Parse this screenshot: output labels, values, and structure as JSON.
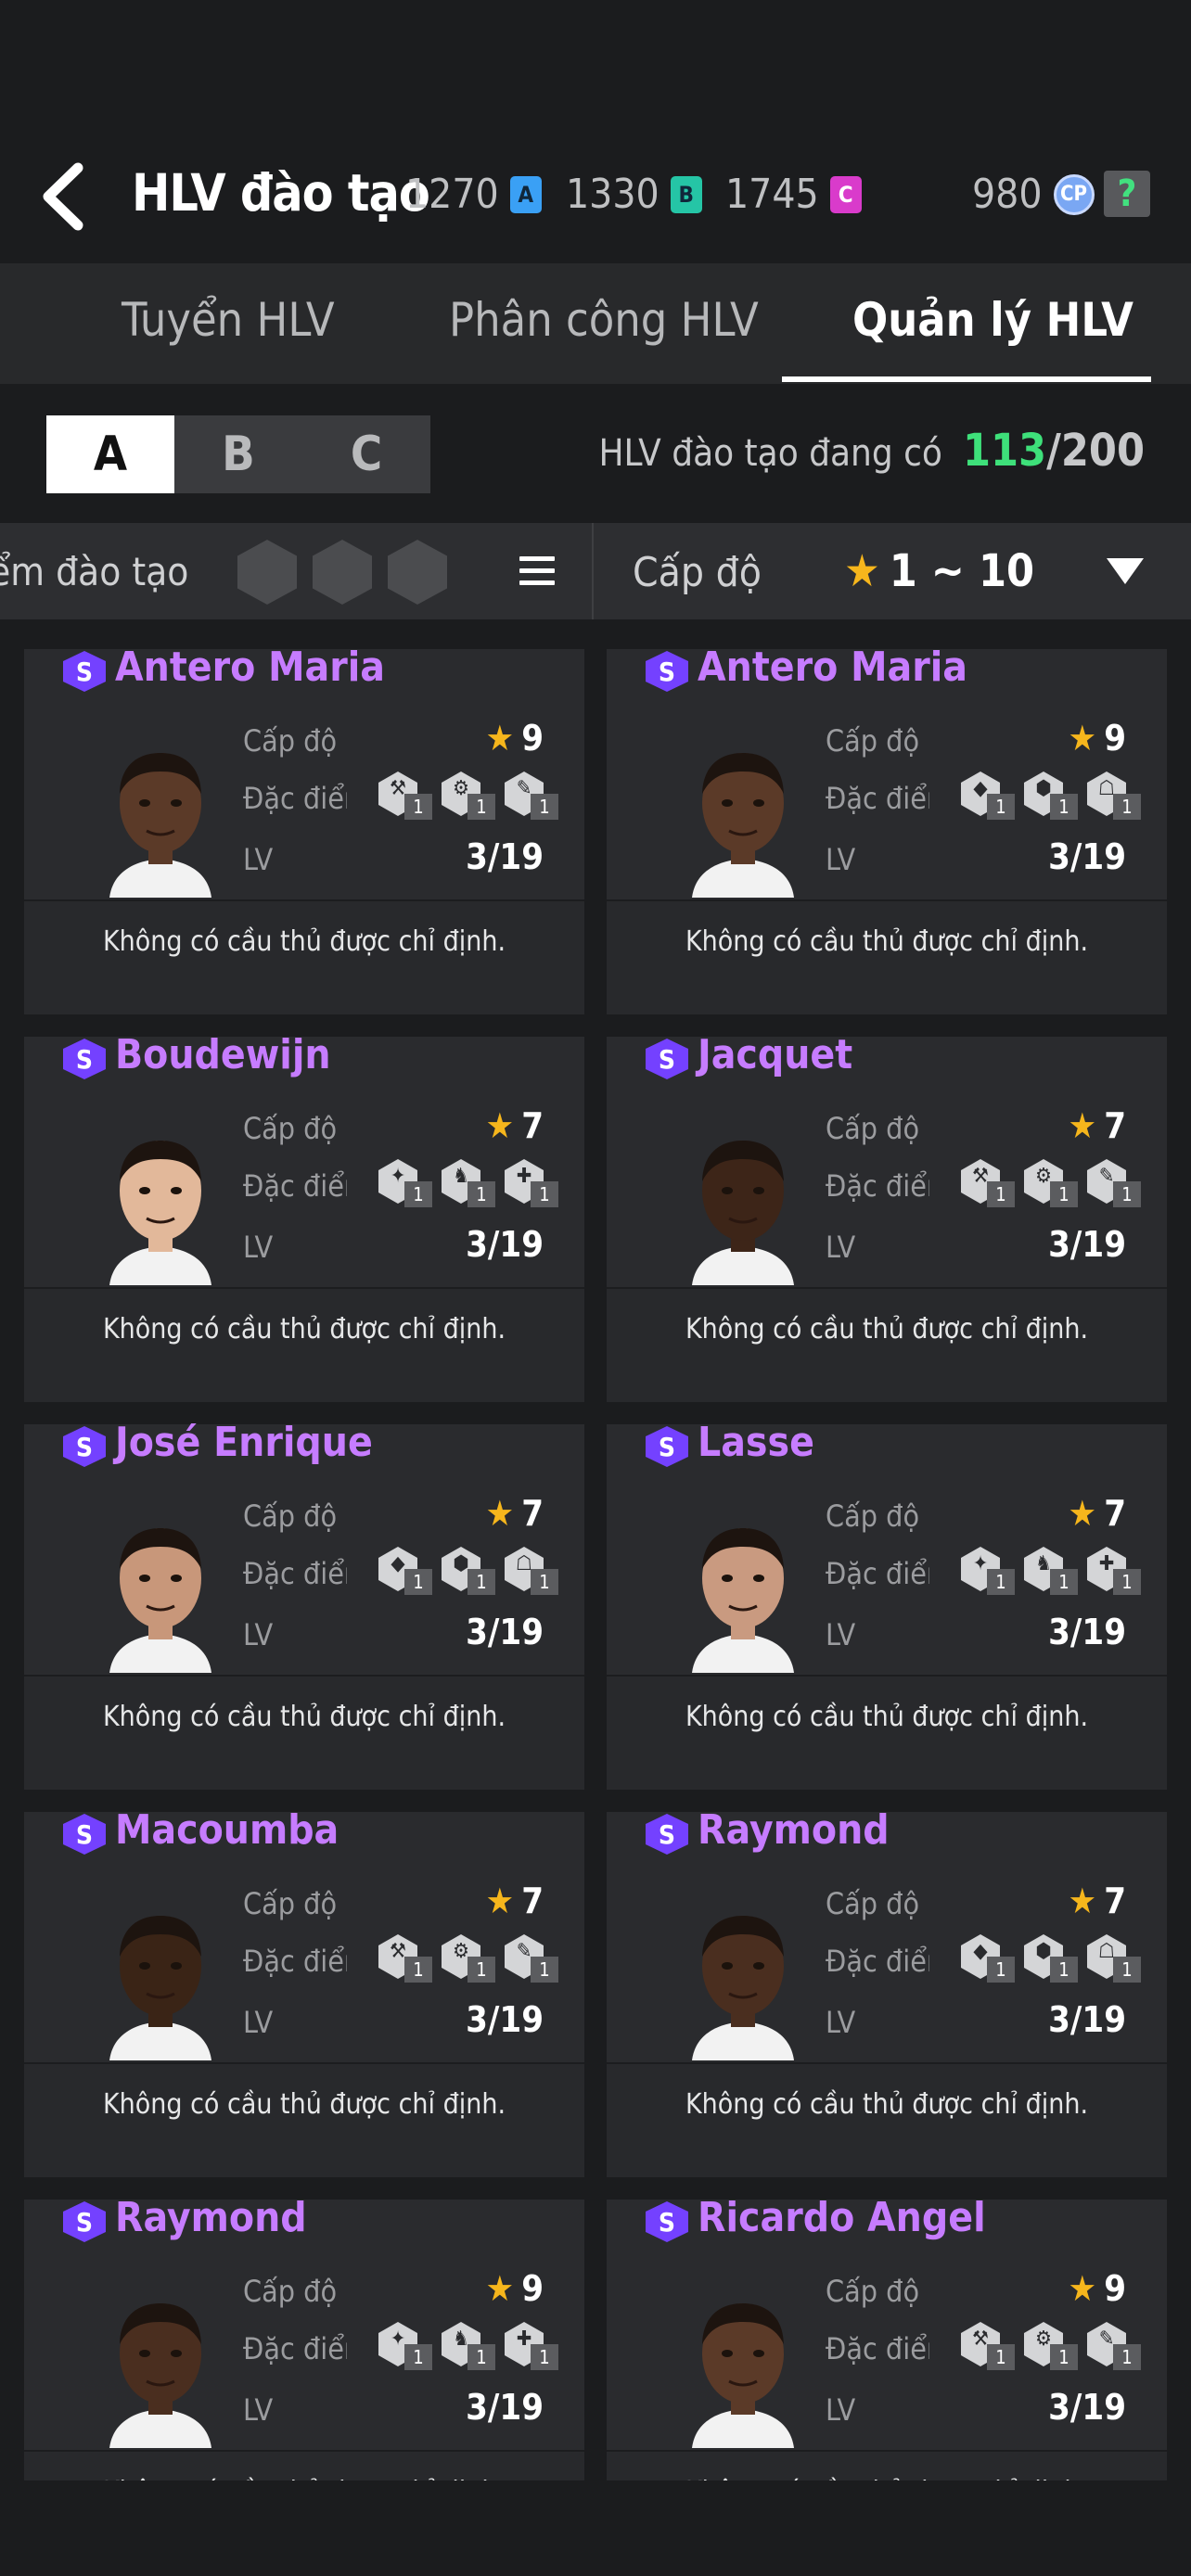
{
  "header": {
    "title": "HLV đào tạo",
    "currencies": [
      {
        "value": "1270",
        "grade": "A",
        "color": "#3aa0f5"
      },
      {
        "value": "1330",
        "grade": "B",
        "color": "#25c5a6"
      },
      {
        "value": "1745",
        "grade": "C",
        "color": "#d93bcb"
      }
    ],
    "cp_value": "980",
    "cp_label": "CP",
    "help_label": "?"
  },
  "tabs": [
    "Tuyển HLV",
    "Phân công HLV",
    "Quản lý HLV"
  ],
  "grade_tabs": [
    "A",
    "B",
    "C"
  ],
  "coach_count": {
    "label": "HLV đào tạo đang có",
    "current": "113",
    "separator": "/",
    "max": "200"
  },
  "filter": {
    "trait_label": "ểm đào tạo",
    "level_label": "Cấp độ",
    "level_star": "★",
    "level_range": "1 ~ 10"
  },
  "card_labels": {
    "level": "Cấp độ",
    "trait": "Đặc điểm",
    "lv": "LV",
    "grade_badge": "S",
    "trait_count": "1",
    "star": "★"
  },
  "coaches": [
    {
      "name": "Antero Maria",
      "level": "9",
      "lv": "3/19",
      "assigned": "Không có cầu thủ được chỉ định.",
      "skin": "#5b3a28"
    },
    {
      "name": "Antero Maria",
      "level": "9",
      "lv": "3/19",
      "assigned": "Không có cầu thủ được chỉ định.",
      "skin": "#5b3a28"
    },
    {
      "name": "Boudewijn",
      "level": "7",
      "lv": "3/19",
      "assigned": "Không có cầu thủ được chỉ định.",
      "skin": "#e2b89a"
    },
    {
      "name": "Jacquet",
      "level": "7",
      "lv": "3/19",
      "assigned": "Không có cầu thủ được chỉ định.",
      "skin": "#3d2518"
    },
    {
      "name": "José Enrique",
      "level": "7",
      "lv": "3/19",
      "assigned": "Không có cầu thủ được chỉ định.",
      "skin": "#c8977a"
    },
    {
      "name": "Lasse",
      "level": "7",
      "lv": "3/19",
      "assigned": "Không có cầu thủ được chỉ định.",
      "skin": "#c99a80"
    },
    {
      "name": "Macoumba",
      "level": "7",
      "lv": "3/19",
      "assigned": "Không có cầu thủ được chỉ định.",
      "skin": "#3a2416"
    },
    {
      "name": "Raymond",
      "level": "7",
      "lv": "3/19",
      "assigned": "Không có cầu thủ được chỉ định.",
      "skin": "#4a2e1f"
    },
    {
      "name": "Raymond",
      "level": "9",
      "lv": "3/19",
      "assigned": "Không có cầu thủ được chỉ định.",
      "skin": "#4a2e1f"
    },
    {
      "name": "Ricardo Angel",
      "level": "9",
      "lv": "3/19",
      "assigned": "Không có cầu thủ được chỉ định.",
      "skin": "#5b3a28"
    }
  ]
}
